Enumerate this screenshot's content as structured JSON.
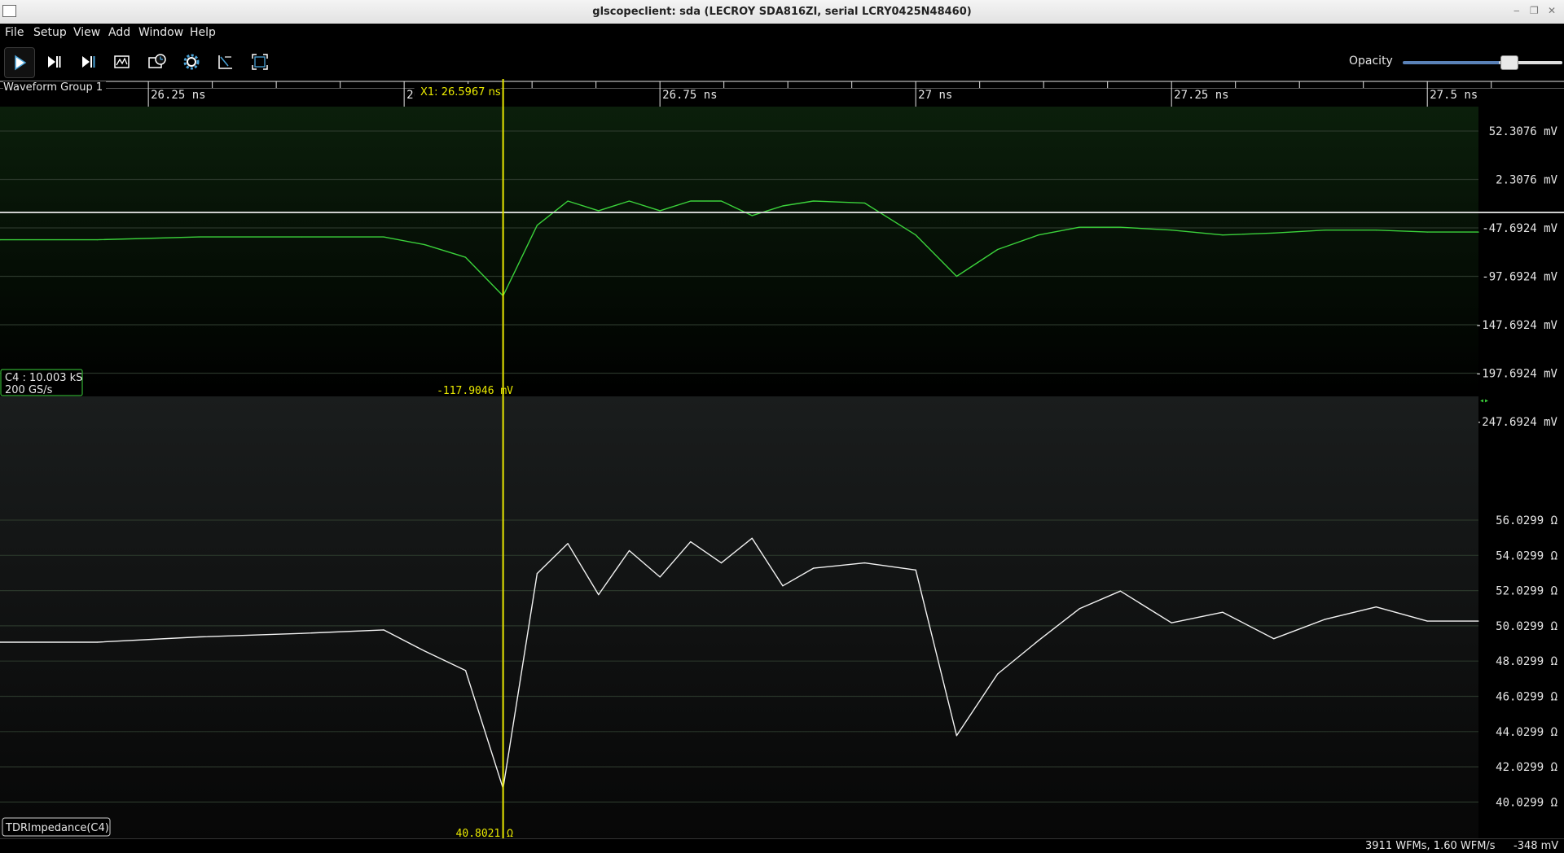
{
  "window": {
    "title": "glscopeclient: sda (LECROY SDA816ZI, serial LCRY0425N48460)",
    "controls": [
      "‒",
      "❐",
      "✕"
    ]
  },
  "menu": [
    "File",
    "Setup",
    "View",
    "Add",
    "Window",
    "Help"
  ],
  "toolbar": {
    "buttons": [
      "start-trigger",
      "single-trigger",
      "force-trigger",
      "history",
      "clock-recovery",
      "settings",
      "fit-horizontal",
      "fullscreen"
    ],
    "opacity_label": "Opacity",
    "opacity_value": 0.68
  },
  "group": {
    "label": "Waveform Group 1",
    "timeline": {
      "labels": [
        "26.25 ns",
        "26.5 ns",
        "26.75 ns",
        "27 ns",
        "27.25 ns",
        "27.5 ns"
      ],
      "start_ns": 26.105,
      "end_ns": 27.55
    },
    "cursor": {
      "label": "X1: 26.5967 ns",
      "time_ns": 26.5967,
      "color": "#e8e800"
    }
  },
  "channels": [
    {
      "name": "C4",
      "info_line1": "C4 : 10.003 kS",
      "info_line2": "200 GS/s",
      "color": "#3bd23b",
      "unit": "mV",
      "y_labels": [
        "52.3076 mV",
        "2.3076 mV",
        "-47.6924 mV",
        "-97.6924 mV",
        "-147.6924 mV",
        "-197.6924 mV",
        "-247.6924 mV"
      ],
      "y_top": 52.3076,
      "y_step": -50,
      "cursor_readout": "-117.9046 mV",
      "offset_marker": "◂▸"
    },
    {
      "name": "TDRImpedance(C4)",
      "info_line1": "TDRImpedance(C4)",
      "color": "#f2f2f2",
      "unit": "Ω",
      "y_labels": [
        "56.0299 Ω",
        "54.0299 Ω",
        "52.0299 Ω",
        "50.0299 Ω",
        "48.0299 Ω",
        "46.0299 Ω",
        "44.0299 Ω",
        "42.0299 Ω",
        "40.0299 Ω"
      ],
      "y_top": 56.0299,
      "y_step": -2,
      "cursor_readout": "40.8021 Ω"
    }
  ],
  "chart_data": {
    "type": "line",
    "x_unit": "ns",
    "x": [
      26.105,
      26.2,
      26.3,
      26.4,
      26.48,
      26.52,
      26.56,
      26.5967,
      26.63,
      26.66,
      26.69,
      26.72,
      26.75,
      26.78,
      26.81,
      26.84,
      26.87,
      26.9,
      26.95,
      27.0,
      27.04,
      27.08,
      27.12,
      27.16,
      27.2,
      27.25,
      27.3,
      27.35,
      27.4,
      27.45,
      27.5,
      27.55
    ],
    "series": [
      {
        "name": "C4",
        "unit": "mV",
        "values": [
          -60,
          -60,
          -57,
          -57,
          -57,
          -65,
          -78,
          -117.9,
          -45,
          -20,
          -30,
          -20,
          -30,
          -20,
          -20,
          -35,
          -25,
          -20,
          -22,
          -55,
          -97.7,
          -70,
          -55,
          -47,
          -47,
          -50,
          -55,
          -53,
          -50,
          -50,
          -52,
          -52
        ]
      },
      {
        "name": "TDRImpedance(C4)",
        "unit": "Ω",
        "values": [
          49.1,
          49.1,
          49.4,
          49.6,
          49.8,
          48.6,
          47.5,
          40.8,
          53.0,
          54.7,
          51.8,
          54.3,
          52.8,
          54.8,
          53.6,
          55.0,
          52.3,
          53.3,
          53.6,
          53.2,
          43.8,
          47.3,
          49.2,
          51.0,
          52.0,
          50.2,
          50.8,
          49.3,
          50.4,
          51.1,
          50.3,
          50.3
        ]
      }
    ]
  },
  "status": {
    "wfms": "3911 WFMs, 1.60 WFM/s",
    "voltage": "-348 mV"
  }
}
